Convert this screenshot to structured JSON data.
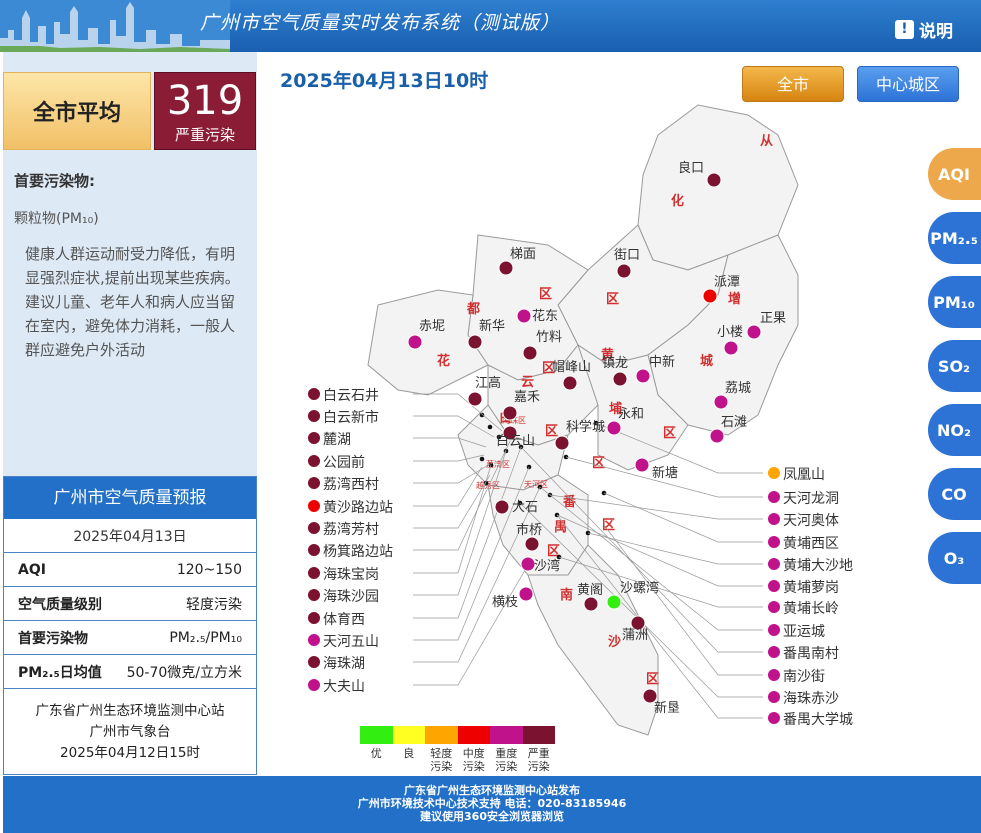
{
  "header": {
    "title": "广州市空气质量实时发布系统（测试版）",
    "help_label": "说明"
  },
  "summary": {
    "label": "全市平均",
    "aqi": "319",
    "level": "严重污染",
    "primary_pollutant_title": "首要污染物:",
    "primary_pollutant": "颗粒物(PM₁₀)",
    "advice": "健康人群运动耐受力降低，有明显强烈症状,提前出现某些疾病。建议儿童、老年人和病人应当留在室内，避免体力消耗，一般人群应避免户外活动"
  },
  "forecast": {
    "title": "广州市空气质量预报",
    "date": "2025年04月13日",
    "rows": [
      {
        "k": "AQI",
        "v": "120~150"
      },
      {
        "k": "空气质量级别",
        "v": "轻度污染"
      },
      {
        "k": "首要污染物",
        "v": "PM₂.₅/PM₁₀"
      },
      {
        "k": "PM₂.₅日均值",
        "v": "50-70微克/立方米"
      }
    ],
    "source": [
      "广东省广州生态环境监测中心站",
      "广州市气象台",
      "2025年04月12日15时"
    ]
  },
  "datetime": "2025年04月13日10时",
  "buttons": {
    "all": "全市",
    "center": "中心城区"
  },
  "pollutant_buttons": [
    {
      "label": "AQI",
      "color": "#eda84c"
    },
    {
      "label": "PM₂.₅",
      "color": "#2d73d6"
    },
    {
      "label": "PM₁₀",
      "color": "#2d73d6"
    },
    {
      "label": "SO₂",
      "color": "#2d73d6"
    },
    {
      "label": "NO₂",
      "color": "#2d73d6"
    },
    {
      "label": "CO",
      "color": "#2d73d6"
    },
    {
      "label": "O₃",
      "color": "#2d73d6"
    }
  ],
  "colors": {
    "优": "#33ee11",
    "良": "#ffff22",
    "轻度污染": "#ffa500",
    "中度污染": "#ee0000",
    "重度污染": "#c0128a",
    "严重污染": "#7a1230"
  },
  "map": {
    "districts": [
      "从",
      "化",
      "区",
      "都",
      "区",
      "花",
      "增",
      "城",
      "区",
      "黄",
      "埔",
      "区",
      "区",
      "云",
      "白",
      "区",
      "区",
      "番",
      "禺",
      "区",
      "南",
      "沙",
      "区",
      "海珠区",
      "荔湾区",
      "越秀区",
      "天河区"
    ],
    "stations": [
      {
        "name": "良口",
        "level": "严重污染"
      },
      {
        "name": "街口",
        "level": "严重污染"
      },
      {
        "name": "派潭",
        "level": "中度污染"
      },
      {
        "name": "梯面",
        "level": "严重污染"
      },
      {
        "name": "花东",
        "level": "重度污染"
      },
      {
        "name": "正果",
        "level": "重度污染"
      },
      {
        "name": "小楼",
        "level": "重度污染"
      },
      {
        "name": "赤坭",
        "level": "重度污染"
      },
      {
        "name": "新华",
        "level": "严重污染"
      },
      {
        "name": "竹料",
        "level": "严重污染"
      },
      {
        "name": "中新",
        "level": "重度污染"
      },
      {
        "name": "帽峰山",
        "level": "严重污染"
      },
      {
        "name": "镇龙",
        "level": "严重污染"
      },
      {
        "name": "荔城",
        "level": "重度污染"
      },
      {
        "name": "江高",
        "level": "严重污染"
      },
      {
        "name": "嘉禾",
        "level": "严重污染"
      },
      {
        "name": "永和",
        "level": "重度污染"
      },
      {
        "name": "石滩",
        "level": "重度污染"
      },
      {
        "name": "白云山",
        "level": "严重污染"
      },
      {
        "name": "科学城",
        "level": "严重污染"
      },
      {
        "name": "新塘",
        "level": "重度污染"
      },
      {
        "name": "大石",
        "level": "严重污染"
      },
      {
        "name": "市桥",
        "level": "严重污染"
      },
      {
        "name": "沙湾",
        "level": "重度污染"
      },
      {
        "name": "黄阁",
        "level": "严重污染"
      },
      {
        "name": "沙螺湾",
        "level": "优"
      },
      {
        "name": "横枝",
        "level": "重度污染"
      },
      {
        "name": "蒲洲",
        "level": "严重污染"
      },
      {
        "name": "新垦",
        "level": "严重污染"
      }
    ],
    "left_labels": [
      {
        "name": "白云石井",
        "level": "严重污染"
      },
      {
        "name": "白云新市",
        "level": "严重污染"
      },
      {
        "name": "麓湖",
        "level": "严重污染"
      },
      {
        "name": "公园前",
        "level": "严重污染"
      },
      {
        "name": "荔湾西村",
        "level": "严重污染"
      },
      {
        "name": "黄沙路边站",
        "level": "中度污染"
      },
      {
        "name": "荔湾芳村",
        "level": "严重污染"
      },
      {
        "name": "杨箕路边站",
        "level": "严重污染"
      },
      {
        "name": "海珠宝岗",
        "level": "严重污染"
      },
      {
        "name": "海珠沙园",
        "level": "严重污染"
      },
      {
        "name": "体育西",
        "level": "严重污染"
      },
      {
        "name": "天河五山",
        "level": "重度污染"
      },
      {
        "name": "海珠湖",
        "level": "严重污染"
      },
      {
        "name": "大夫山",
        "level": "重度污染"
      }
    ],
    "right_labels": [
      {
        "name": "凤凰山",
        "level": "轻度污染"
      },
      {
        "name": "天河龙洞",
        "level": "重度污染"
      },
      {
        "name": "天河奥体",
        "level": "重度污染"
      },
      {
        "name": "黄埔西区",
        "level": "重度污染"
      },
      {
        "name": "黄埔大沙地",
        "level": "重度污染"
      },
      {
        "name": "黄埔萝岗",
        "level": "重度污染"
      },
      {
        "name": "黄埔长岭",
        "level": "重度污染"
      },
      {
        "name": "亚运城",
        "level": "重度污染"
      },
      {
        "name": "番禺南村",
        "level": "重度污染"
      },
      {
        "name": "南沙街",
        "level": "重度污染"
      },
      {
        "name": "海珠赤沙",
        "level": "重度污染"
      },
      {
        "name": "番禺大学城",
        "level": "重度污染"
      }
    ]
  },
  "legend": [
    {
      "label": "优",
      "color": "#33ee11"
    },
    {
      "label": "良",
      "color": "#ffff22"
    },
    {
      "label": "轻度污染",
      "color": "#ffa500"
    },
    {
      "label": "中度污染",
      "color": "#ee0000"
    },
    {
      "label": "重度污染",
      "color": "#c0128a"
    },
    {
      "label": "严重污染",
      "color": "#7a1230"
    }
  ],
  "footer": [
    "广东省广州生态环境监测中心站发布",
    "广州市环境技术中心技术支持 电话：020-83185946",
    "建议使用360安全浏览器浏览"
  ]
}
